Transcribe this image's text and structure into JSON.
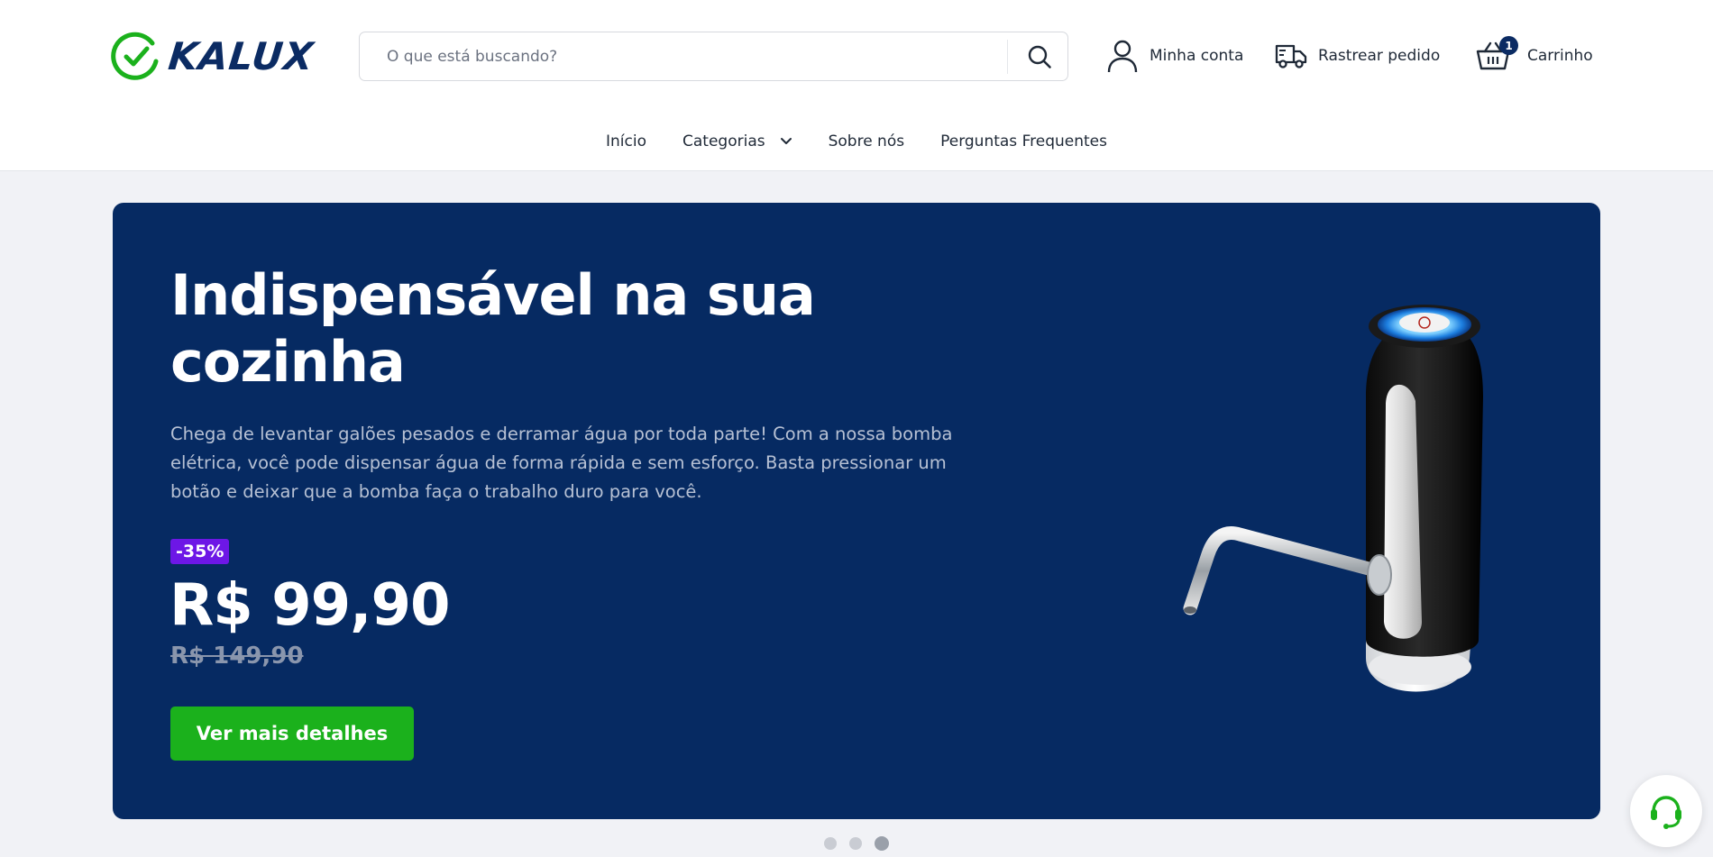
{
  "brand": {
    "name": "KALUX",
    "logo_color": "#0b2b63",
    "check_color": "#1bb11c"
  },
  "search": {
    "placeholder": "O que está buscando?",
    "value": "",
    "icon": "search-icon"
  },
  "header_links": {
    "account": {
      "label": "Minha conta",
      "icon": "user-icon"
    },
    "track": {
      "label": "Rastrear pedido",
      "icon": "truck-icon"
    },
    "cart": {
      "label": "Carrinho",
      "icon": "basket-icon",
      "count": "1"
    }
  },
  "nav": {
    "items": [
      {
        "label": "Início"
      },
      {
        "label": "Categorias",
        "icon": "chevron-down-icon"
      },
      {
        "label": "Sobre nós"
      },
      {
        "label": "Perguntas Frequentes"
      }
    ]
  },
  "hero": {
    "title": "Indispensável na sua cozinha",
    "description": "Chega de levantar galões pesados e derramar água por toda parte! Com a nossa bomba elétrica, você pode dispensar água de forma rápida e sem esforço. Basta pressionar um botão e deixar que a bomba faça o trabalho duro para você.",
    "discount_badge": "-35%",
    "price": "R$ 99,90",
    "old_price": "R$ 149,90",
    "cta_label": "Ver mais detalhes",
    "background_color": "#062a62",
    "cta_color": "#1bb11c",
    "badge_color": "#6d17e6",
    "product_image": "water-pump-dispenser-image"
  },
  "carousel": {
    "slides": 3,
    "active_index": 2
  },
  "support_button": {
    "icon": "headset-icon",
    "color": "#1bb11c"
  }
}
